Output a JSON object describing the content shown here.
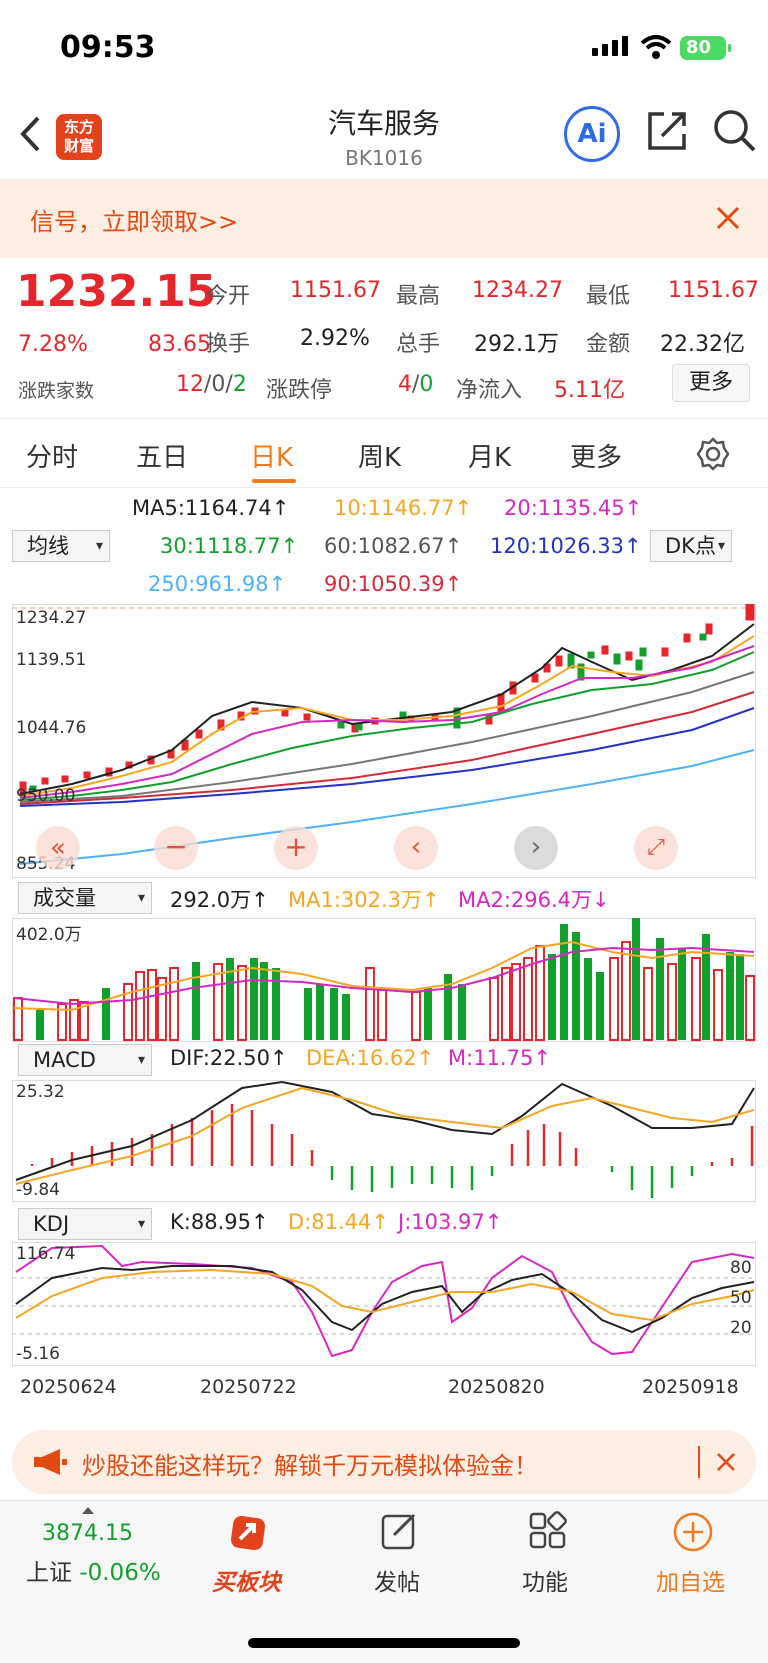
{
  "status": {
    "time": "09:53",
    "battery": "80"
  },
  "nav": {
    "logo_line1": "东方",
    "logo_line2": "财富",
    "title": "汽车服务",
    "code": "BK1016",
    "ai": "Ai"
  },
  "banner": {
    "text": "信号，立即领取>>"
  },
  "quote": {
    "price": "1232.15",
    "pct": "7.28%",
    "chg": "83.65",
    "open_label": "今开",
    "open": "1151.67",
    "high_label": "最高",
    "high": "1234.27",
    "low_label": "最低",
    "low": "1151.67",
    "turn_label": "换手",
    "turn": "2.92%",
    "vol_label": "总手",
    "vol": "292.1万",
    "amt_label": "金额",
    "amt": "22.32亿",
    "ud_label": "涨跌家数",
    "up": "12",
    "flat": "0",
    "down": "2",
    "limit_label": "涨跌停",
    "limit_up": "4",
    "limit_down": "0",
    "flow_label": "净流入",
    "flow": "5.11亿",
    "more": "更多",
    "slash": "/"
  },
  "tabs": [
    "分时",
    "五日",
    "日K",
    "周K",
    "月K",
    "更多"
  ],
  "ma": {
    "selector": "均线",
    "dk": "DK点",
    "ma5": "MA5:1164.74↑",
    "ma10": "10:1146.77↑",
    "ma20": "20:1135.45↑",
    "ma30": "30:1118.77↑",
    "ma60": "60:1082.67↑",
    "ma120": "120:1026.33↑",
    "ma250": "250:961.98↑",
    "ma90": "90:1050.39↑"
  },
  "kaxis": {
    "top": "1234.27",
    "a": "1139.51",
    "b": "1044.76",
    "c": "950.00",
    "bottom": "855.24"
  },
  "vol": {
    "selector": "成交量",
    "value": "292.0万↑",
    "ma1": "MA1:302.3万↑",
    "ma2": "MA2:296.4万↓",
    "max": "402.0万"
  },
  "macd": {
    "selector": "MACD",
    "dif": "DIF:22.50↑",
    "dea": "DEA:16.62↑",
    "m": "M:11.75↑",
    "top": "25.32",
    "bottom": "-9.84"
  },
  "kdj": {
    "selector": "KDJ",
    "k": "K:88.95↑",
    "d": "D:81.44↑",
    "j": "J:103.97↑",
    "top": "116.74",
    "bottom": "-5.16",
    "l80": "80",
    "l50": "50",
    "l20": "20"
  },
  "dates": [
    "20250624",
    "20250722",
    "20250820",
    "20250918"
  ],
  "ad": {
    "text": "炒股还能这样玩？解锁千万元模拟体验金！"
  },
  "bottom": {
    "index_value": "3874.15",
    "index_name": "上证",
    "index_pct": "-0.06%",
    "buy": "买板块",
    "post": "发帖",
    "func": "功能",
    "add": "加自选"
  },
  "colors": {
    "up": "#e5262b",
    "down": "#12a02c",
    "accent": "#f07a1c"
  }
}
